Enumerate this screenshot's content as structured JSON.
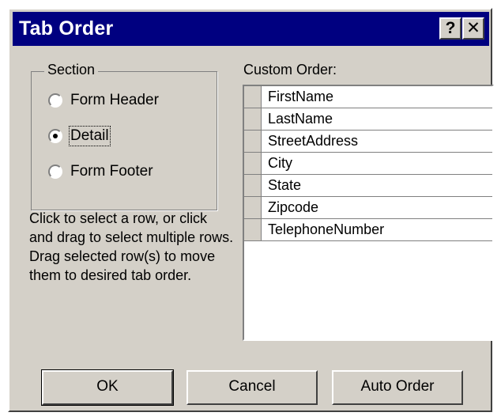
{
  "window": {
    "title": "Tab Order"
  },
  "titlebar_buttons": {
    "help": "?",
    "close": "✕"
  },
  "section": {
    "label": "Section",
    "options": [
      {
        "label": "Form Header",
        "checked": false
      },
      {
        "label": "Detail",
        "checked": true
      },
      {
        "label": "Form Footer",
        "checked": false
      }
    ]
  },
  "help_text": "Click to select a row, or click and drag to select multiple rows.  Drag selected row(s) to move them to desired tab order.",
  "custom_order": {
    "label": "Custom Order:",
    "items": [
      "FirstName",
      "LastName",
      "StreetAddress",
      "City",
      "State",
      "Zipcode",
      "TelephoneNumber"
    ]
  },
  "buttons": {
    "ok": "OK",
    "cancel": "Cancel",
    "auto_order": "Auto Order"
  }
}
